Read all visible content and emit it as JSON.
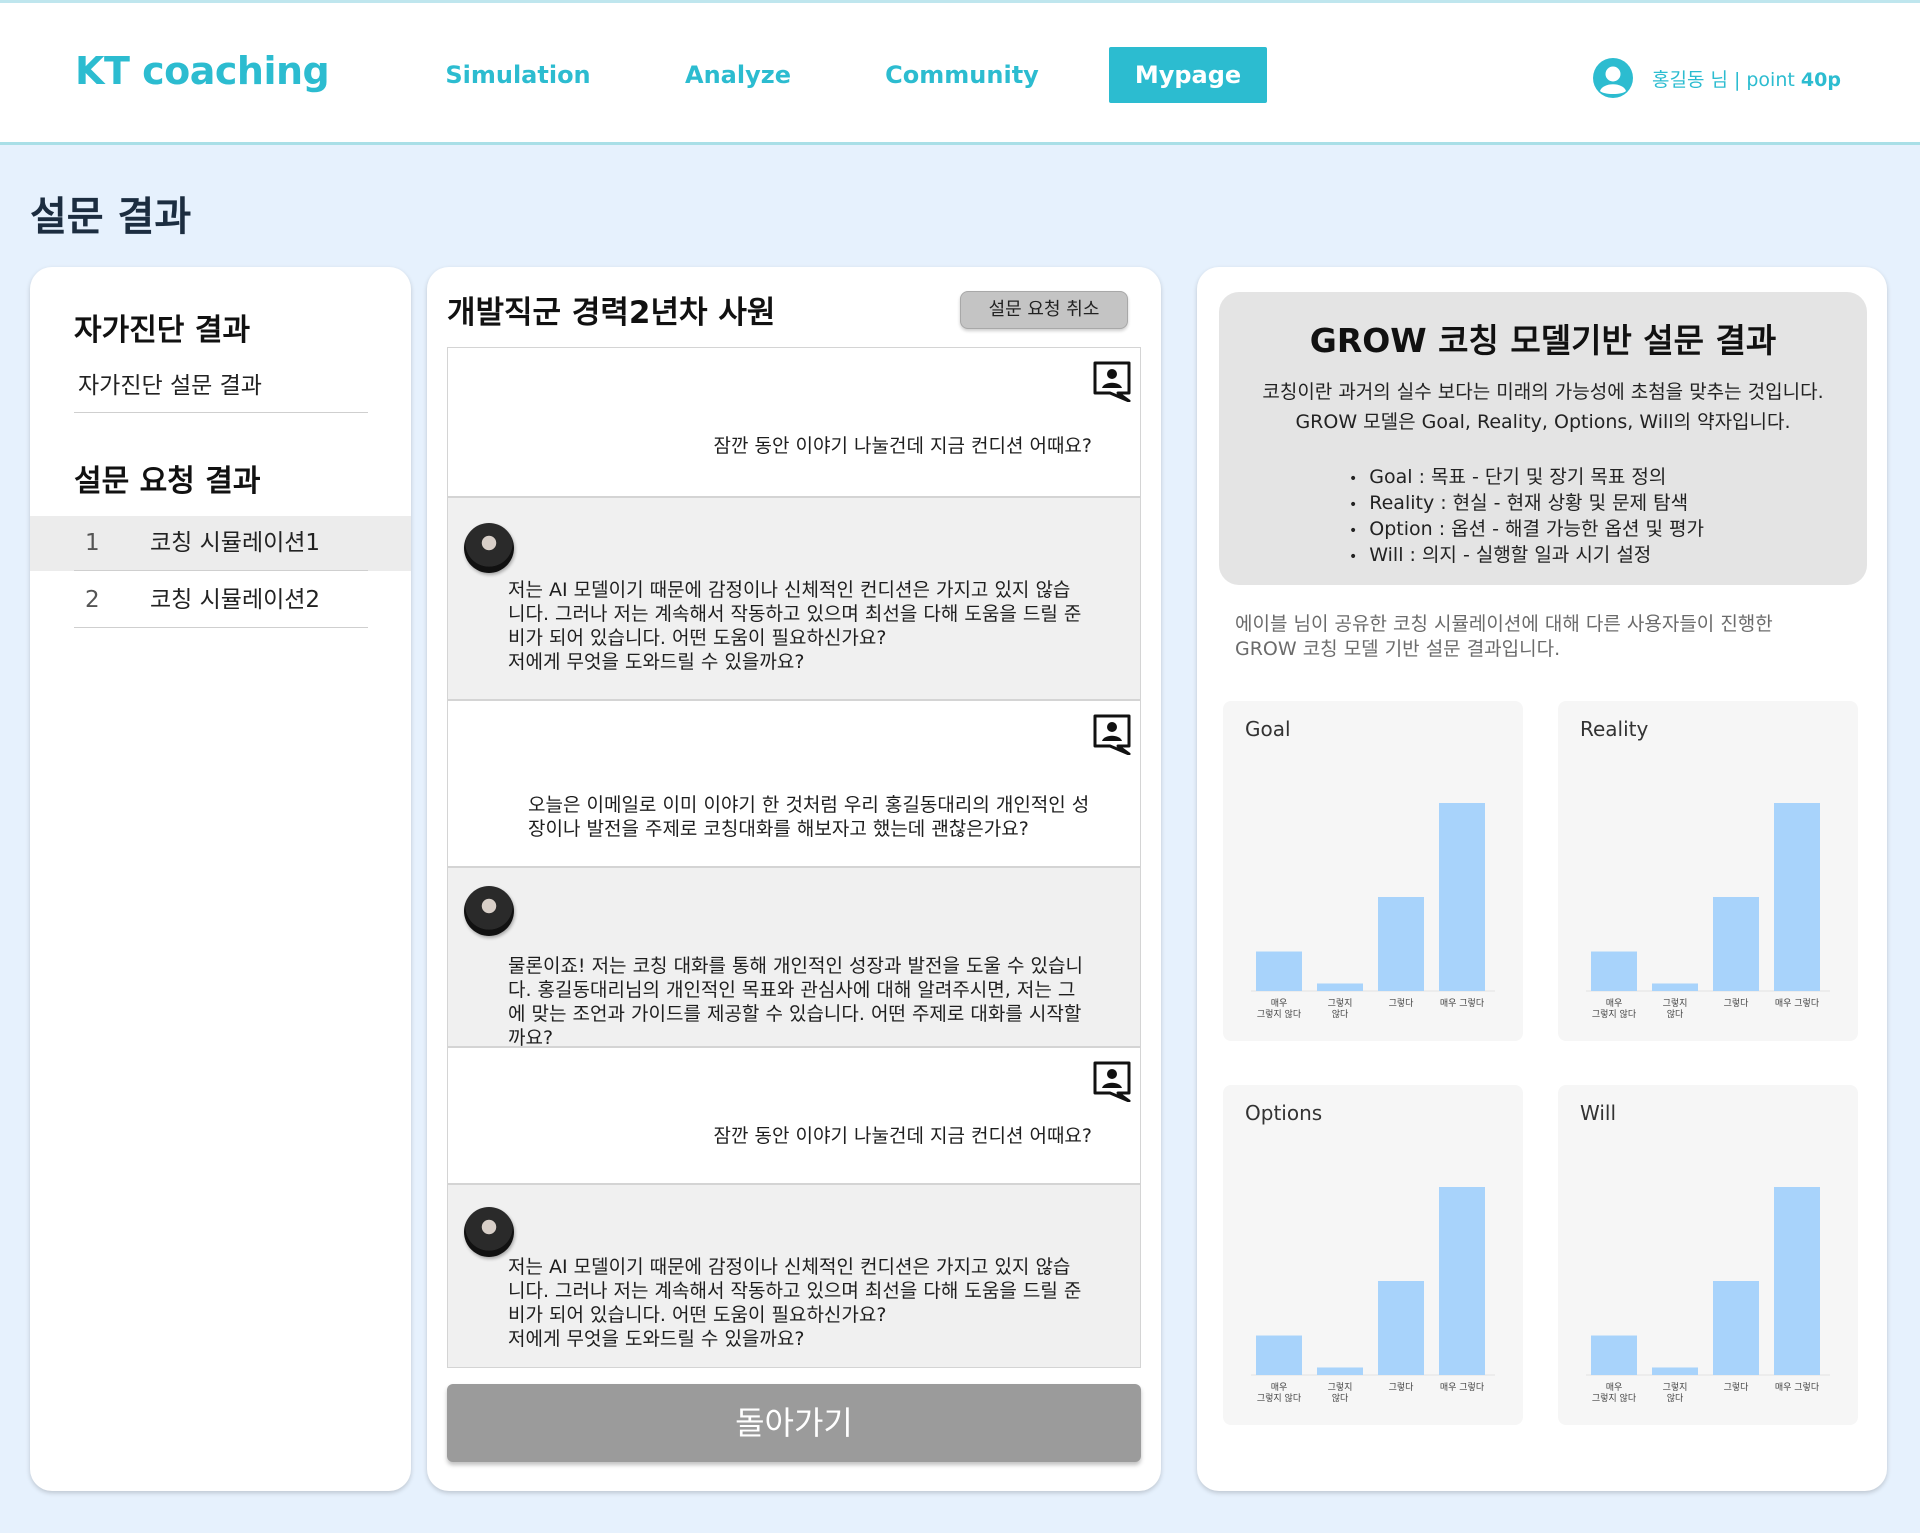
{
  "header": {
    "logo": "KT coaching",
    "nav": [
      {
        "label": "Simulation",
        "active": false
      },
      {
        "label": "Analyze",
        "active": false
      },
      {
        "label": "Community",
        "active": false
      },
      {
        "label": "Mypage",
        "active": true
      }
    ],
    "user_name": "홍길동 님",
    "point_label": "point",
    "point_value": "40p"
  },
  "page_title": "설문 결과",
  "left": {
    "self_title": "자가진단 결과",
    "self_item": "자가진단 설문 결과",
    "request_title": "설문 요청 결과",
    "requests": [
      {
        "num": "1",
        "name": "코칭 시뮬레이션1",
        "selected": true
      },
      {
        "num": "2",
        "name": "코칭 시뮬레이션2",
        "selected": false
      }
    ]
  },
  "middle": {
    "title": "개발직군 경력2년차 사원",
    "cancel_label": "설문 요청 취소",
    "messages": [
      {
        "role": "user",
        "text": "잠깐 동안 이야기 나눌건데 지금 컨디션 어때요?"
      },
      {
        "role": "ai",
        "lines": [
          "저는 AI 모델이기 때문에 감정이나 신체적인 컨디션은 가지고 있지 않습",
          "니다. 그러나 저는 계속해서 작동하고 있으며 최선을 다해 도움을 드릴 준",
          "비가 되어 있습니다. 어떤 도움이 필요하신가요?",
          "저에게 무엇을 도와드릴 수 있을까요?"
        ]
      },
      {
        "role": "user",
        "lines": [
          "오늘은 이메일로 이미 이야기 한 것처럼 우리 홍길동대리의 개인적인 성",
          "장이나 발전을 주제로 코칭대화를 해보자고 했는데 괜찮은가요?"
        ]
      },
      {
        "role": "ai",
        "lines": [
          "물론이죠! 저는 코칭 대화를 통해 개인적인 성장과 발전을 도울 수 있습니",
          "다. 홍길동대리님의 개인적인 목표와 관심사에 대해 알려주시면, 저는 그",
          "에 맞는 조언과 가이드를 제공할 수 있습니다. 어떤 주제로 대화를 시작할",
          "까요?"
        ]
      },
      {
        "role": "user",
        "text": "잠깐 동안 이야기 나눌건데 지금 컨디션 어때요?"
      },
      {
        "role": "ai",
        "lines": [
          "저는 AI 모델이기 때문에 감정이나 신체적인 컨디션은 가지고 있지 않습",
          "니다. 그러나 저는 계속해서 작동하고 있으며 최선을 다해 도움을 드릴 준",
          "비가 되어 있습니다. 어떤 도움이 필요하신가요?",
          "저에게 무엇을 도와드릴 수 있을까요?"
        ]
      }
    ],
    "back_label": "돌아가기"
  },
  "right": {
    "grow_title": "GROW 코칭 모델기반 설문 결과",
    "grow_desc_1": "코칭이란 과거의 실수 보다는 미래의 가능성에 초첨을 맞추는 것입니다.",
    "grow_desc_2": "GROW 모델은 Goal, Reality, Options, Will의 약자입니다.",
    "grow_items": [
      "Goal : 목표 - 단기 및 장기 목표 정의",
      "Reality : 현실 - 현재 상황 및 문제 탐색",
      "Option : 옵션 - 해결 가능한 옵션 및 평가",
      "Will : 의지 - 실행할 일과 시기 설정"
    ],
    "share_desc_1": "에이블 님이 공유한 코칭 시뮬레이션에 대해 다른 사용자들이 진행한",
    "share_desc_2": "GROW 코칭 모델 기반 설문 결과입니다.",
    "bar_color": "#a8d3fb"
  },
  "chart_data": [
    {
      "type": "bar",
      "title": "Goal",
      "categories": [
        "매우 그렇지 않다",
        "그렇지 않다",
        "그렇다",
        "매우 그렇다"
      ],
      "category_lines": [
        [
          "매우",
          "그렇지 않다"
        ],
        [
          "그렇지",
          "않다"
        ],
        [
          "그렇다"
        ],
        [
          "매우 그렇다"
        ]
      ],
      "values": [
        21,
        4,
        50,
        100
      ],
      "ylim": [
        0,
        100
      ],
      "grid": false
    },
    {
      "type": "bar",
      "title": "Reality",
      "categories": [
        "매우 그렇지 않다",
        "그렇지 않다",
        "그렇다",
        "매우 그렇다"
      ],
      "category_lines": [
        [
          "매우",
          "그렇지 않다"
        ],
        [
          "그렇지",
          "않다"
        ],
        [
          "그렇다"
        ],
        [
          "매우 그렇다"
        ]
      ],
      "values": [
        21,
        4,
        50,
        100
      ],
      "ylim": [
        0,
        100
      ],
      "grid": false
    },
    {
      "type": "bar",
      "title": "Options",
      "categories": [
        "매우 그렇지 않다",
        "그렇지 않다",
        "그렇다",
        "매우 그렇다"
      ],
      "category_lines": [
        [
          "매우",
          "그렇지 않다"
        ],
        [
          "그렇지",
          "않다"
        ],
        [
          "그렇다"
        ],
        [
          "매우 그렇다"
        ]
      ],
      "values": [
        21,
        4,
        50,
        100
      ],
      "ylim": [
        0,
        100
      ],
      "grid": false
    },
    {
      "type": "bar",
      "title": "Will",
      "categories": [
        "매우 그렇지 않다",
        "그렇지 않다",
        "그렇다",
        "매우 그렇다"
      ],
      "category_lines": [
        [
          "매우",
          "그렇지 않다"
        ],
        [
          "그렇지",
          "않다"
        ],
        [
          "그렇다"
        ],
        [
          "매우 그렇다"
        ]
      ],
      "values": [
        21,
        4,
        50,
        100
      ],
      "ylim": [
        0,
        100
      ],
      "grid": false
    }
  ]
}
